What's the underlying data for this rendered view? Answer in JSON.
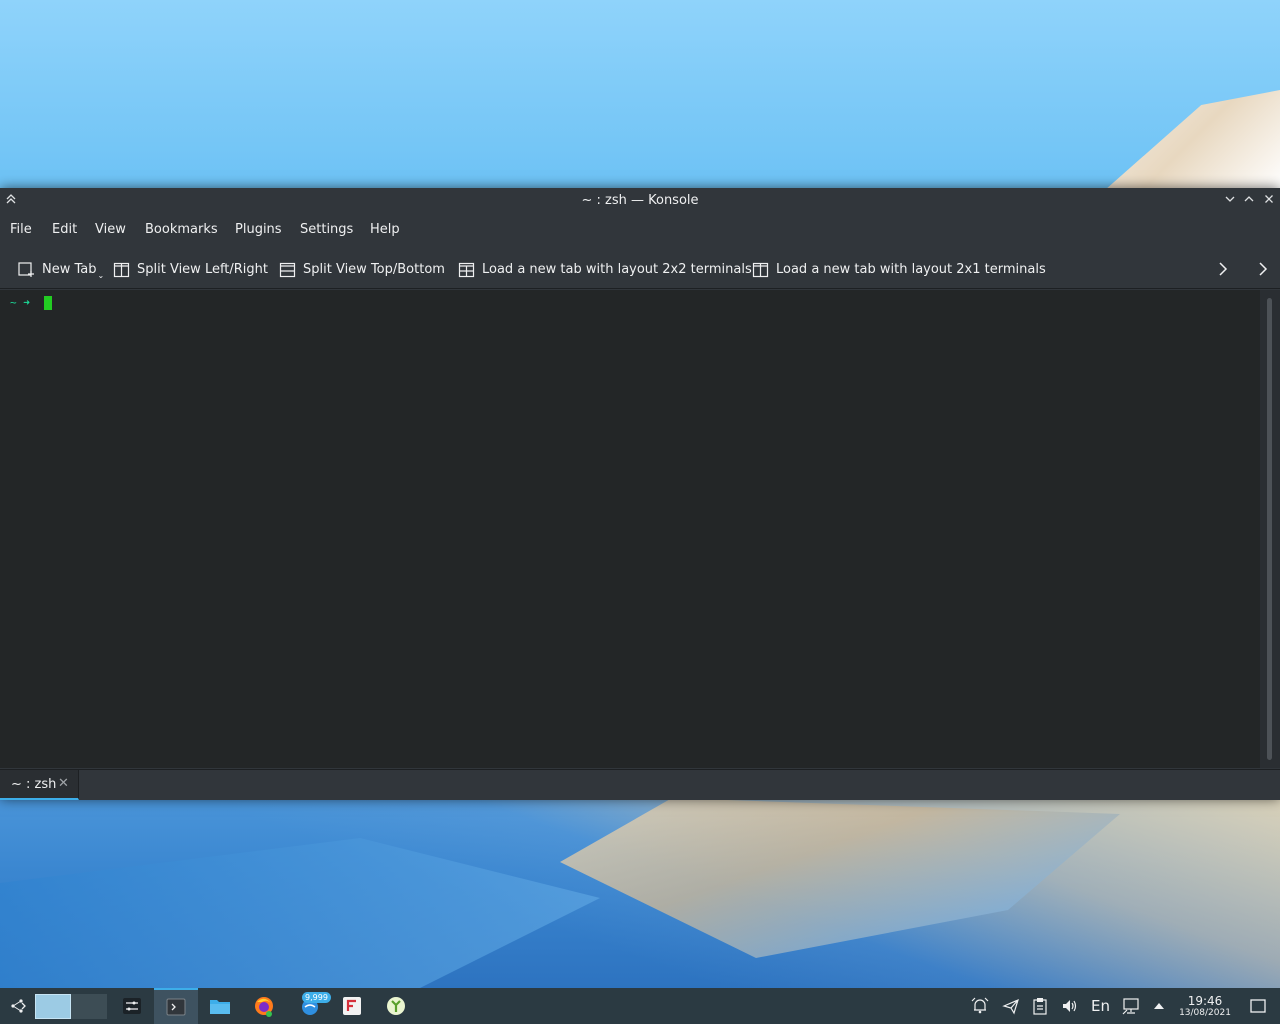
{
  "window": {
    "title": "~ : zsh — Konsole"
  },
  "menu": {
    "items": [
      "File",
      "Edit",
      "View",
      "Bookmarks",
      "Plugins",
      "Settings",
      "Help"
    ]
  },
  "toolbar": {
    "new_tab": "New Tab",
    "split_lr": "Split View Left/Right",
    "split_tb": "Split View Top/Bottom",
    "layout_2x2": "Load a new tab with layout 2x2 terminals",
    "layout_2x1": "Load a new tab with layout 2x1 terminals"
  },
  "terminal": {
    "prompt": "~ ➜"
  },
  "tabs": [
    {
      "label": "~ : zsh"
    }
  ],
  "taskbar": {
    "badge_count": "9,999",
    "keyboard_layout": "En",
    "time": "19:46",
    "date": "13/08/2021"
  },
  "colors": {
    "accent": "#3daee9",
    "window_bg": "#31363b",
    "terminal_bg": "#232627",
    "prompt": "#1cdc9a",
    "cursor": "#22cc22"
  }
}
